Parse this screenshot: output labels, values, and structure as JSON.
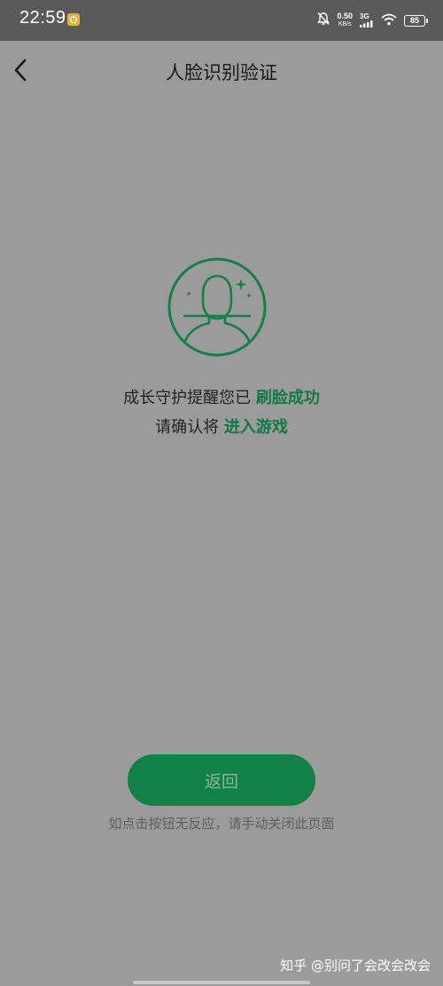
{
  "status_bar": {
    "time": "22:59",
    "net_speed_value": "0.50",
    "net_speed_unit": "KB/s",
    "network_type": "3G",
    "battery_level": "85",
    "icons": [
      "app-notification-icon",
      "bell-muted-icon",
      "signal-icon",
      "wifi-icon",
      "battery-icon"
    ]
  },
  "header": {
    "title": "人脸识别验证",
    "back_icon": "chevron-left-icon"
  },
  "face_icon": "face-recognition-icon",
  "message": {
    "line1_prefix": "成长守护提醒您已 ",
    "line1_highlight": "刷脸成功",
    "line2_prefix": "请确认将 ",
    "line2_highlight": "进入游戏"
  },
  "actions": {
    "return_label": "返回",
    "hint": "如点击按钮无反应，请手动关闭此页面"
  },
  "watermark": "知乎 @别问了会改会改会",
  "colors": {
    "accent": "#128148",
    "highlight_text": "#117a43",
    "overlay": "#9b9b9b",
    "status_bar": "#5a5a5a"
  }
}
